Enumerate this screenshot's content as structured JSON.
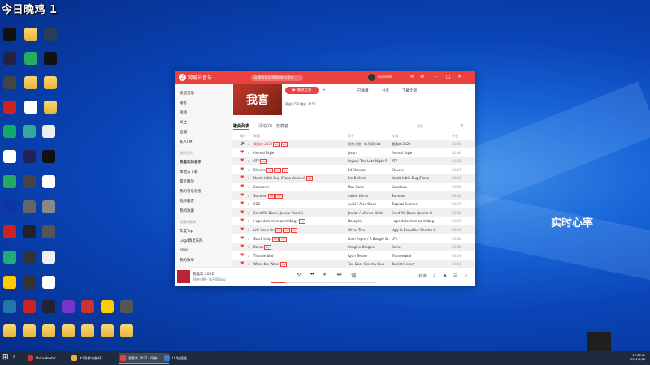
{
  "overlay": {
    "title": "今日晚鸡 1",
    "heart_rate_label": "实时心率"
  },
  "desktop_icons": [
    {
      "name": "capcut-icon",
      "color": "#111"
    },
    {
      "name": "folder-icon",
      "color": "folder"
    },
    {
      "name": "app-a-icon",
      "color": "#2a3e5a"
    },
    {
      "name": "app-icon",
      "color": "#224"
    },
    {
      "name": "app-green-icon",
      "color": "#27ae60"
    },
    {
      "name": "tiktok-icon",
      "color": "#111"
    },
    {
      "name": "app-icon",
      "color": "#444"
    },
    {
      "name": "folder-icon",
      "color": "folder"
    },
    {
      "name": "folder-icon",
      "color": "folder"
    },
    {
      "name": "app-red-icon",
      "color": "#c22"
    },
    {
      "name": "doc-icon",
      "color": "#fff"
    },
    {
      "name": "folder-icon",
      "color": "folder"
    }
  ],
  "window": {
    "app_name": "网易云音乐",
    "search_placeholder": "Q 搜索音乐/视频/电台/用户",
    "username": "Likesnow",
    "sidebar": {
      "items": [
        "发现音乐",
        "播客",
        "视频",
        "关注",
        "直播",
        "私人FM"
      ],
      "section_mine": "我的音乐",
      "mine_items": [
        "我喜欢的音乐",
        "本地与下载",
        "最近播放",
        "我的音乐云盘",
        "我的播客",
        "我的收藏"
      ],
      "section_created": "创建的歌单",
      "created_items": [
        "年度Top",
        "Lego精灵乐队",
        "emo",
        "我的歌单",
        "ss"
      ]
    },
    "header": {
      "cover_text": "我喜",
      "play_all": "▶ 播放全部",
      "collect": "已收藏",
      "share": "分享",
      "download": "下载全部",
      "meta": "歌曲 158  播放 3456"
    },
    "tabs": [
      "歌曲列表",
      "评论(0)",
      "收藏者"
    ],
    "search_in_list": "搜索",
    "columns": [
      "操作",
      "标题",
      "歌手",
      "专辑",
      "时长"
    ],
    "songs": [
      {
        "title": "我喜欢 2022",
        "tags": [
          "SQ",
          "VIP"
        ],
        "artist": "阿奈小朋 - 朱不同Sido",
        "album": "我喜欢 2022",
        "time": "02:40",
        "playing": true
      },
      {
        "title": "Animal Style",
        "tags": [],
        "artist": "Jason",
        "album": "Animal Style",
        "time": "02:46"
      },
      {
        "title": "ATP",
        "tags": [
          "SQ"
        ],
        "artist": "Psyko / The Late Night P",
        "album": "ATP",
        "time": "03:36"
      },
      {
        "title": "Shivers",
        "tags": [
          "SQ",
          "VIP",
          "MV"
        ],
        "artist": "Ed Sheeran",
        "album": "Shivers",
        "time": "03:27"
      },
      {
        "title": "Numb Little Bug (Piano Version)",
        "tags": [
          "SQ"
        ],
        "artist": "Em Beihold",
        "album": "Numb Little Bug (Piano",
        "time": "02:44"
      },
      {
        "title": "Sawdown",
        "tags": [],
        "artist": "Max Gone",
        "album": "Sawdown",
        "time": "02:55"
      },
      {
        "title": "Summer",
        "tags": [
          "SQ",
          "VIP"
        ],
        "artist": "Calvin Harris",
        "album": "Summer",
        "time": "03:44"
      },
      {
        "title": "SOS",
        "tags": [],
        "artist": "Avicii / Aloe Blacc",
        "album": "Tropical Summer",
        "time": "02:37"
      },
      {
        "title": "Send Me Down (Jessiar Remix)",
        "tags": [],
        "artist": "Jessiar / Lifonne Wilde",
        "album": "Send Me Down (Jessiar R",
        "time": "02:38"
      },
      {
        "title": "i wpe dale siem ac milbagy",
        "tags": [
          "VIP"
        ],
        "artist": "Nosophie",
        "album": "i wpe dale siem ac milbag",
        "time": "02:47"
      },
      {
        "title": "Life Goes On",
        "tags": [
          "SQ",
          "VIP",
          "MV"
        ],
        "artist": "Oliver Tree",
        "album": "Ugly Is Beautiful: Shorter &",
        "time": "02:41"
      },
      {
        "title": "Stack It Up",
        "tags": [
          "SQ",
          "VIP"
        ],
        "artist": "Liam Payne / A Boogie Wi",
        "album": "LP1",
        "time": "03:30"
      },
      {
        "title": "Bones",
        "tags": [
          "SQ"
        ],
        "artist": "Imagine Dragons",
        "album": "Bones",
        "time": "02:45"
      },
      {
        "title": "Thunderbird",
        "tags": [],
        "artist": "Ryan Tedder",
        "album": "Thunderbird",
        "time": "03:04"
      },
      {
        "title": "When the Wave",
        "tags": [
          "SQ"
        ],
        "artist": "Two Door Cinema Club",
        "album": "Tourist History",
        "time": "03:11"
      }
    ],
    "player": {
      "title": "我喜欢 2022",
      "artist": "阿奈小朋 - 朱不同Sido",
      "time": "00:22 / 02:40",
      "progress": 0.14
    }
  },
  "taskbar": {
    "items": [
      {
        "label": "VoiceMeeter",
        "color": "#c33"
      },
      {
        "label": "X:\\录像\\电脑环",
        "color": "#e8b53a"
      },
      {
        "label": "我喜欢 2022 - 阿奈...",
        "color": "#ec4141"
      },
      {
        "label": "UU加速器",
        "color": "#3a7bd5"
      }
    ],
    "clock_time": "15:39:21",
    "clock_date": "2022/8/18"
  }
}
